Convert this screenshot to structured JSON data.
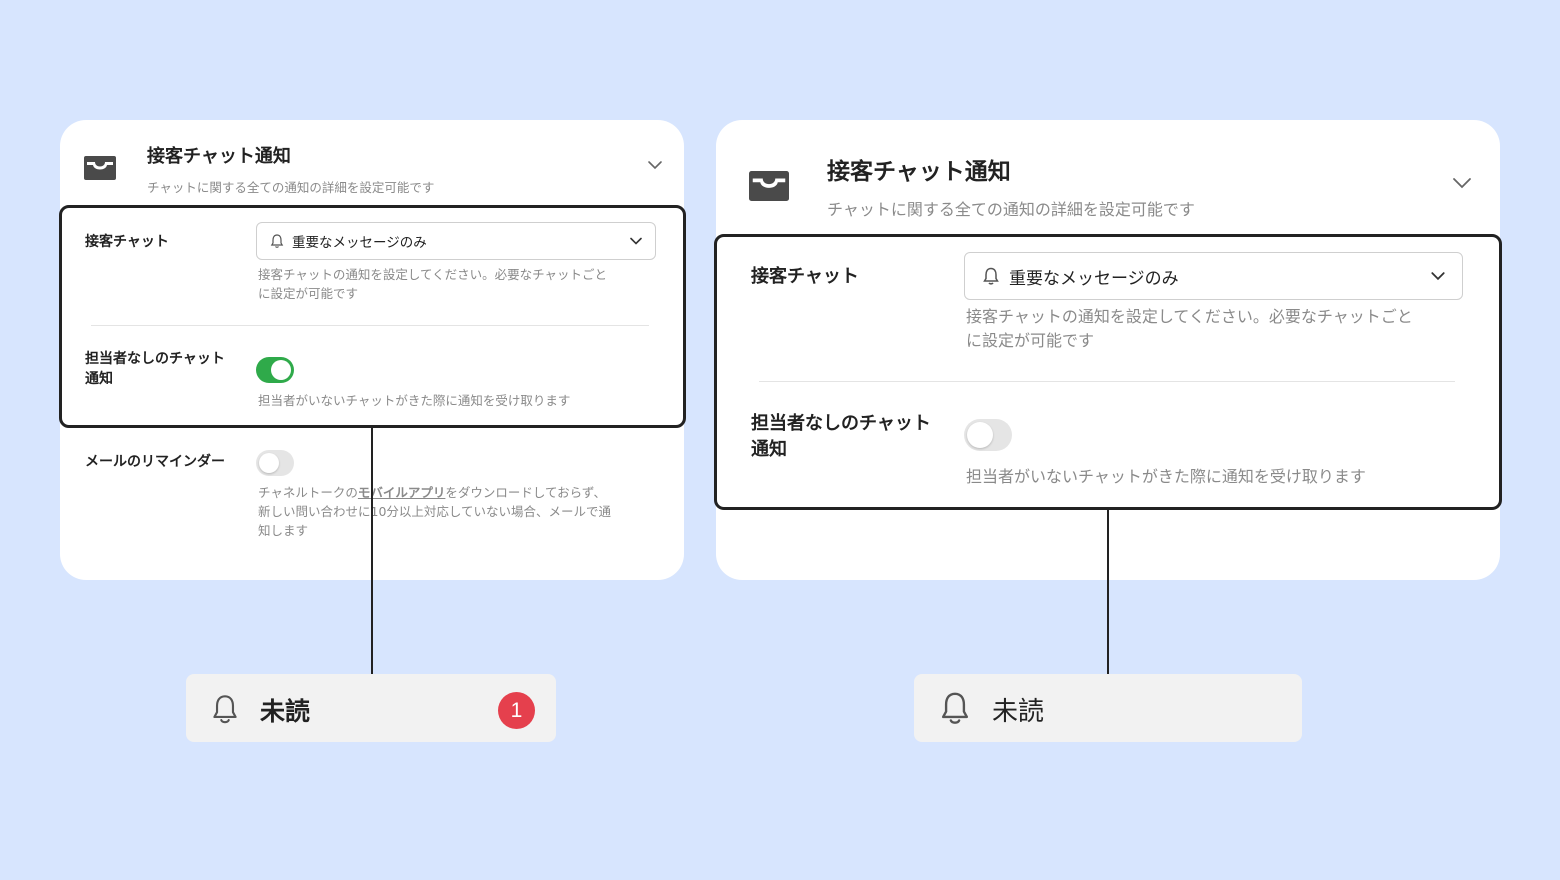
{
  "colors": {
    "background": "#d7e5fe",
    "toggle_on": "#2faa4a",
    "toggle_off": "#e5e5e5",
    "badge": "#e5404d"
  },
  "left_panel": {
    "icon": "inbox-icon",
    "title": "接客チャット通知",
    "subtitle": "チャットに関する全ての通知の詳細を設定可能です",
    "chat_row": {
      "label": "接客チャット",
      "select_value": "重要なメッセージのみ",
      "select_icon": "bell-icon",
      "help_line1": "接客チャットの通知を設定してください。必要なチャットごと",
      "help_line2": "に設定が可能です"
    },
    "unassigned_row": {
      "label_line1": "担当者なしのチャット",
      "label_line2": "通知",
      "toggle_on": true,
      "help": "担当者がいないチャットがきた際に通知を受け取ります"
    },
    "mail_row": {
      "label": "メールのリマインダー",
      "toggle_on": false,
      "help_pre": "チャネルトークの",
      "help_link": "モバイルアプリ",
      "help_post": "をダウンロードしておらず、",
      "help_line2": "新しい問い合わせに10分以上対応していない場合、メールで通",
      "help_line3": "知します"
    }
  },
  "right_panel": {
    "icon": "inbox-icon",
    "title": "接客チャット通知",
    "subtitle": "チャットに関する全ての通知の詳細を設定可能です",
    "chat_row": {
      "label": "接客チャット",
      "select_value": "重要なメッセージのみ",
      "select_icon": "bell-icon",
      "help_line1": "接客チャットの通知を設定してください。必要なチャットごと",
      "help_line2": "に設定が可能です"
    },
    "unassigned_row": {
      "label_line1": "担当者なしのチャット",
      "label_line2": "通知",
      "toggle_on": false,
      "help": "担当者がいないチャットがきた際に通知を受け取ります"
    }
  },
  "left_unread": {
    "icon": "bell-icon",
    "label": "未読",
    "badge": "1"
  },
  "right_unread": {
    "icon": "bell-icon",
    "label": "未読"
  }
}
